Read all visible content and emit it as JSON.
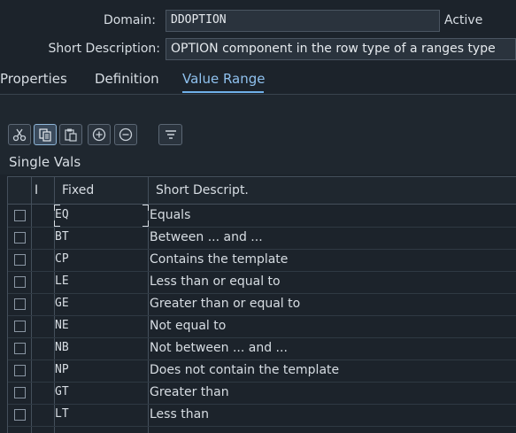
{
  "header": {
    "domain_label": "Domain:",
    "domain_value": "DDOPTION",
    "status": "Active",
    "short_desc_label": "Short Description:",
    "short_desc_value": "OPTION component in the row type of a ranges type"
  },
  "tabs": [
    {
      "label": "Properties",
      "active": false
    },
    {
      "label": "Definition",
      "active": false
    },
    {
      "label": "Value Range",
      "active": true
    }
  ],
  "toolbar": {
    "buttons": [
      "cut-icon",
      "copy-icon",
      "paste-icon",
      "add-row-icon",
      "remove-row-icon",
      "filter-icon"
    ]
  },
  "section": {
    "title": "Single Vals"
  },
  "table": {
    "columns": [
      "I",
      "Fixed",
      "Short Descript."
    ],
    "rows": [
      {
        "code": "EQ",
        "desc": "Equals"
      },
      {
        "code": "BT",
        "desc": "Between ... and ..."
      },
      {
        "code": "CP",
        "desc": "Contains the template"
      },
      {
        "code": "LE",
        "desc": "Less than or equal to"
      },
      {
        "code": "GE",
        "desc": "Greater than or equal to"
      },
      {
        "code": "NE",
        "desc": "Not equal to"
      },
      {
        "code": "NB",
        "desc": "Not between ... and ..."
      },
      {
        "code": "NP",
        "desc": "Does not contain the template"
      },
      {
        "code": "GT",
        "desc": "Greater than"
      },
      {
        "code": "LT",
        "desc": "Less than"
      }
    ]
  },
  "colors": {
    "background": "#1c232b",
    "accent": "#8fc1ee",
    "field": "#2a333d"
  }
}
